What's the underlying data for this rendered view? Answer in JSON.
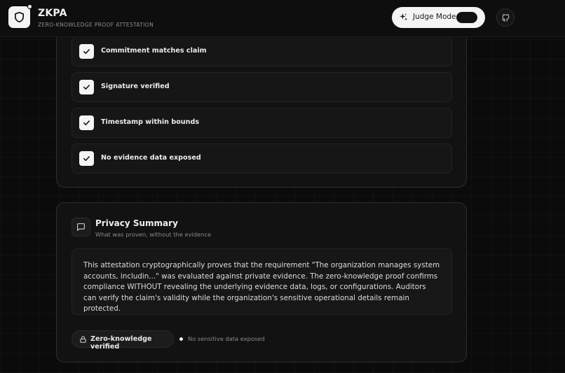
{
  "header": {
    "brand": "ZKPA",
    "subtitle": "ZERO-KNOWLEDGE PROOF ATTESTATION",
    "judge_mode_label": "Judge Mode"
  },
  "checks": [
    {
      "label": "Commitment matches claim"
    },
    {
      "label": "Signature verified"
    },
    {
      "label": "Timestamp within bounds"
    },
    {
      "label": "No evidence data exposed"
    }
  ],
  "privacy": {
    "title": "Privacy Summary",
    "subtitle": "What was proven, without the evidence",
    "body": "This attestation cryptographically proves that the requirement \"The organization manages system accounts, includin...\" was evaluated against private evidence. The zero-knowledge proof confirms compliance WITHOUT revealing the underlying evidence data, logs, or configurations. Auditors can verify the claim's validity while the organization's sensitive operational details remain protected.",
    "badge_label": "Zero-knowledge verified",
    "status_text": "No sensitive data exposed"
  },
  "icons": {
    "logo": "shield-icon",
    "judge": "sparkle-icon",
    "github": "github-icon",
    "check": "check-icon",
    "privacy": "message-square-icon",
    "lock": "lock-icon"
  },
  "colors": {
    "background": "#0b0b0b",
    "card": "#121212",
    "accent": "#f4f4f4"
  }
}
